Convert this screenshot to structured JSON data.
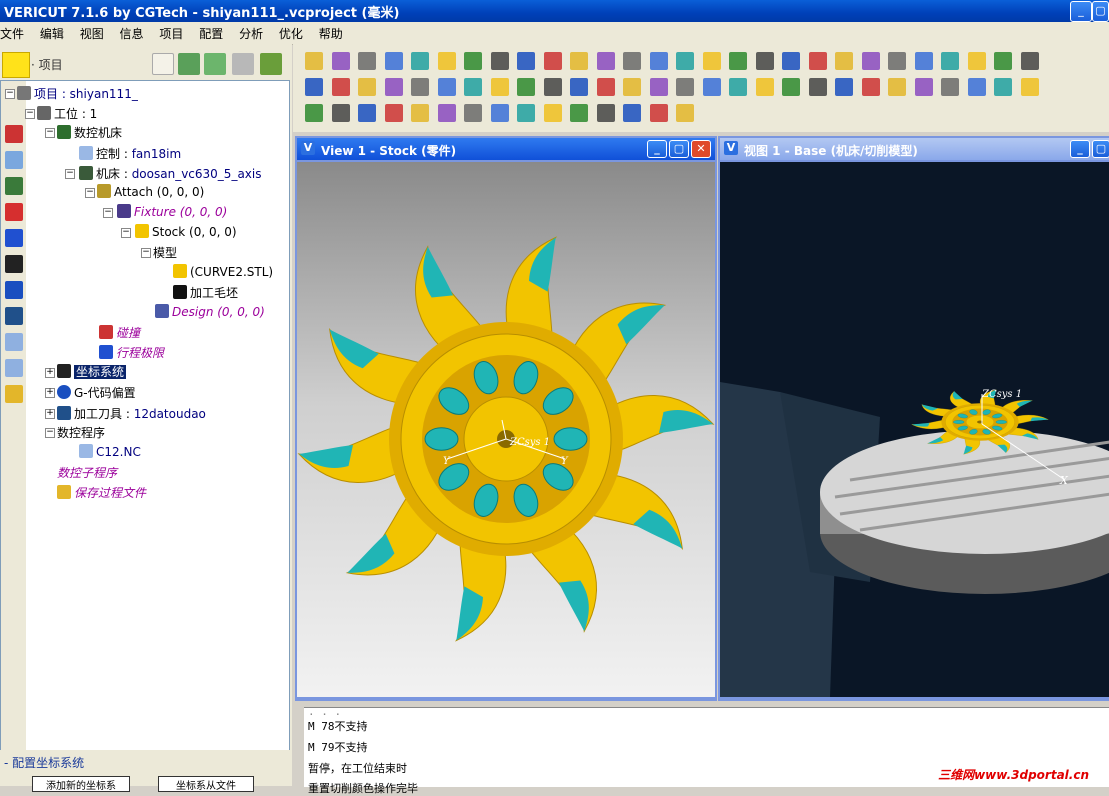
{
  "window": {
    "title": "VERICUT 7.1.6 by CGTech - shiyan111_.vcproject (毫米)"
  },
  "menu": [
    "文件",
    "编辑",
    "视图",
    "信息",
    "项目",
    "配置",
    "分析",
    "优化",
    "帮助"
  ],
  "left": {
    "header": "项目",
    "tree": {
      "project": "项目 : shiyan111_",
      "setup": "工位 : 1",
      "machine_group": "数控机床",
      "control": "控制 :",
      "control_value": "fan18im",
      "machine": "机床 :",
      "machine_value": "doosan_vc630_5_axis",
      "attach": "Attach (0, 0, 0)",
      "fixture": "Fixture (0, 0, 0)",
      "stock": "Stock (0, 0, 0)",
      "model": "模型",
      "stl": "(CURVE2.STL)",
      "blank": "加工毛坯",
      "design": "Design (0, 0, 0)",
      "collision": "碰撞",
      "travel_limits": "行程极限",
      "csys": "坐标系统",
      "gcode_offsets": "G-代码偏置",
      "tooling": "加工刀具 :",
      "tooling_value": "12datoudao",
      "nc_programs": "数控程序",
      "nc_file": "C12.NC",
      "subroutines": "数控子程序",
      "save_process": "保存过程文件"
    },
    "status_label": "配置坐标系统",
    "buttons": [
      "添加新的坐标系",
      "坐标系从文件"
    ]
  },
  "views": {
    "view1_title": "View 1 - Stock (零件)",
    "view2_title": "视图 1 - Base (机床/切削模型)",
    "axis_labels": {
      "csys": "ZCsys 1",
      "x": "X",
      "y": "Y"
    }
  },
  "console": {
    "lines": [
      "M 78不支持",
      "M 79不支持",
      "暂停，在工位结束时",
      "重置切削颜色操作完毕"
    ]
  },
  "watermark": "三维网www.3dportal.cn",
  "colors": {
    "part": "#f2c400",
    "pocket": "#20b5b5",
    "title_blue": "#0a50d0"
  }
}
